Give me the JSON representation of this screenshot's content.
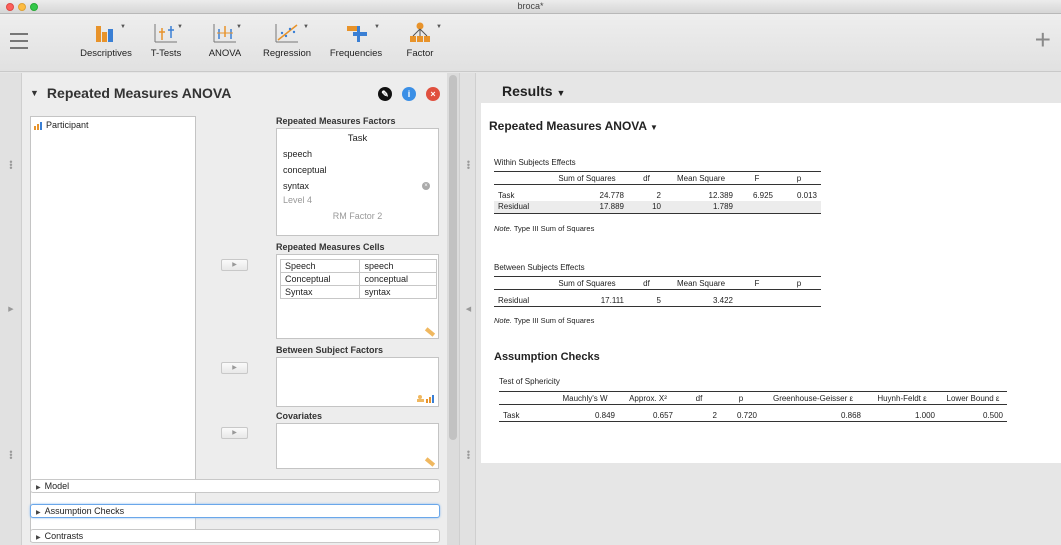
{
  "window": {
    "title": "broca*"
  },
  "ribbon": {
    "buttons": [
      {
        "label": "Descriptives",
        "icon": "descriptives-icon"
      },
      {
        "label": "T-Tests",
        "icon": "ttests-icon"
      },
      {
        "label": "ANOVA",
        "icon": "anova-icon"
      },
      {
        "label": "Regression",
        "icon": "regression-icon"
      },
      {
        "label": "Frequencies",
        "icon": "frequencies-icon"
      },
      {
        "label": "Factor",
        "icon": "factor-icon"
      }
    ],
    "colors": {
      "orange": "#e8932a",
      "blue": "#3a7fd4"
    }
  },
  "analysis": {
    "title": "Repeated Measures ANOVA",
    "variables": [
      "Participant"
    ],
    "rm_factors_label": "Repeated Measures Factors",
    "rm_factor": {
      "name": "Task",
      "levels": [
        "speech",
        "conceptual",
        "syntax"
      ],
      "new_level_placeholder": "Level 4",
      "new_factor_placeholder": "RM Factor 2"
    },
    "rm_cells_label": "Repeated Measures Cells",
    "rm_cells": [
      [
        "Speech",
        "speech"
      ],
      [
        "Conceptual",
        "conceptual"
      ],
      [
        "Syntax",
        "syntax"
      ]
    ],
    "between_label": "Between Subject Factors",
    "covariates_label": "Covariates",
    "sections": [
      "Model",
      "Assumption Checks",
      "Contrasts"
    ]
  },
  "results": {
    "title": "Results",
    "analysis_title": "Repeated Measures ANOVA",
    "within": {
      "caption": "Within Subjects Effects",
      "headers": [
        "",
        "Sum of Squares",
        "df",
        "Mean Square",
        "F",
        "p"
      ],
      "rows": [
        [
          "Task",
          "24.778",
          "2",
          "12.389",
          "6.925",
          "0.013"
        ],
        [
          "Residual",
          "17.889",
          "10",
          "1.789",
          "",
          ""
        ]
      ],
      "note_label": "Note.",
      "note": "Type III Sum of Squares"
    },
    "between": {
      "caption": "Between Subjects Effects",
      "headers": [
        "",
        "Sum of Squares",
        "df",
        "Mean Square",
        "F",
        "p"
      ],
      "rows": [
        [
          "Residual",
          "17.111",
          "5",
          "3.422",
          "",
          ""
        ]
      ],
      "note_label": "Note.",
      "note": "Type III Sum of Squares"
    },
    "assumptions_title": "Assumption Checks",
    "sphericity": {
      "caption": "Test of Sphericity",
      "headers": [
        "",
        "Mauchly's W",
        "Approx. Χ²",
        "df",
        "p",
        "Greenhouse-Geisser ε",
        "Huynh-Feldt ε",
        "Lower Bound ε"
      ],
      "rows": [
        [
          "Task",
          "0.849",
          "0.657",
          "2",
          "0.720",
          "0.868",
          "1.000",
          "0.500"
        ]
      ]
    }
  }
}
